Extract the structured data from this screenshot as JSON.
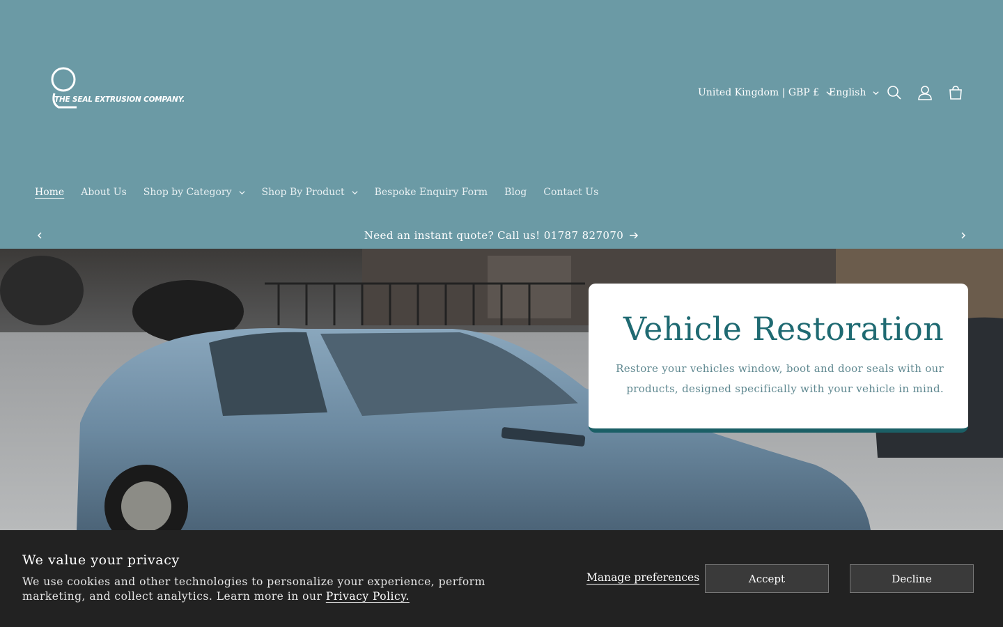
{
  "brand": {
    "logo_text": "THE SEAL EXTRUSION COMPANY."
  },
  "header": {
    "country_selector": "United Kingdom | GBP £",
    "language_selector": "English",
    "icons": [
      "search-icon",
      "account-icon",
      "cart-icon"
    ]
  },
  "nav": {
    "items": [
      {
        "label": "Home",
        "dropdown": false,
        "active": true
      },
      {
        "label": "About Us",
        "dropdown": false
      },
      {
        "label": "Shop by Category",
        "dropdown": true
      },
      {
        "label": "Shop By Product",
        "dropdown": true
      },
      {
        "label": "Bespoke Enquiry Form",
        "dropdown": false
      },
      {
        "label": "Blog",
        "dropdown": false
      },
      {
        "label": "Contact Us",
        "dropdown": false
      }
    ]
  },
  "announcement": {
    "text": "Need an instant quote? Call us! 01787 827070"
  },
  "hero": {
    "title": "Vehicle Restoration",
    "description": "Restore your vehicles window, boot and door seals with our products, designed specifically with your vehicle in mind."
  },
  "cookie": {
    "title": "We value your privacy",
    "text": "We use cookies and other technologies to personalize your experience, perform marketing, and collect analytics. Learn more in our ",
    "link": "Privacy Policy.",
    "manage_label": "Manage preferences",
    "accept_label": "Accept",
    "decline_label": "Decline"
  },
  "colors": {
    "header_bg": "#6b9aa5",
    "hero_title": "#1f6a72",
    "card_accent": "#1b5f66",
    "cookie_bg": "#222222"
  }
}
